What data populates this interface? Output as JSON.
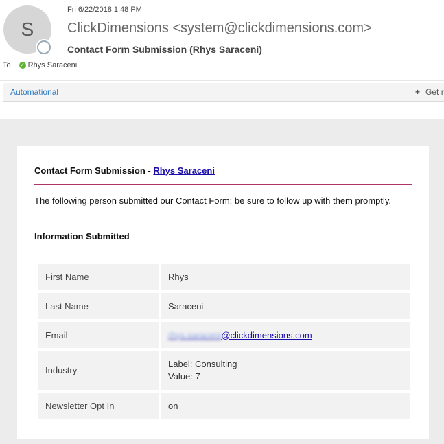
{
  "header": {
    "avatar_letter": "S",
    "date": "Fri 6/22/2018 1:48 PM",
    "sender": "ClickDimensions <system@clickdimensions.com>",
    "subject": "Contact Form Submission (Rhys Saraceni)",
    "to_label": "To",
    "recipient": "Rhys Saraceni"
  },
  "addin_bar": {
    "name": "Automational",
    "get_label": "Get r"
  },
  "email": {
    "title_prefix": "Contact Form Submission - ",
    "title_link": "Rhys Saraceni",
    "intro": "The following person submitted our Contact Form; be sure to follow up with them promptly.",
    "section_heading": "Information Submitted",
    "fields": {
      "first_name": {
        "label": "First Name",
        "value": "Rhys"
      },
      "last_name": {
        "label": "Last Name",
        "value": "Saraceni"
      },
      "email": {
        "label": "Email",
        "value_redacted": "rhys.saraceni",
        "value_domain": "@clickdimensions.com"
      },
      "industry": {
        "label": "Industry",
        "value_line1": "Label: Consulting",
        "value_line2": "Value: 7"
      },
      "newsletter": {
        "label": "Newsletter Opt In",
        "value": "on"
      }
    }
  },
  "colors": {
    "accent_rule": "#b0336a",
    "link": "#1a0dab",
    "addin_link": "#2b79c2",
    "presence_check": "#5fb336"
  }
}
